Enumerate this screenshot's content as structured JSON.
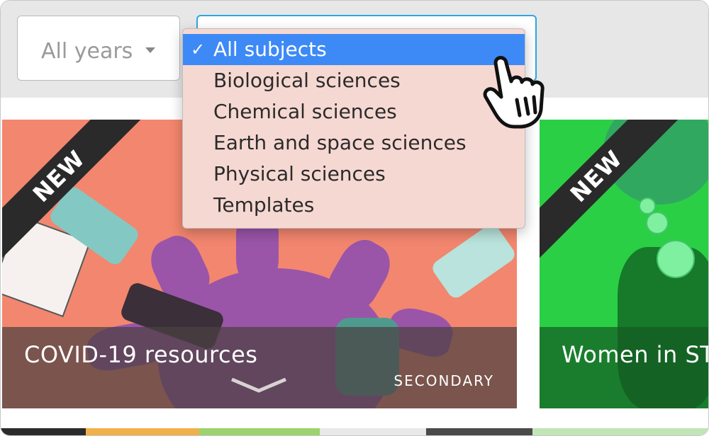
{
  "filters": {
    "year_select": {
      "value": "All years"
    },
    "subject_select": {
      "options": [
        {
          "label": "All subjects",
          "selected": true
        },
        {
          "label": "Biological sciences",
          "selected": false
        },
        {
          "label": "Chemical sciences",
          "selected": false
        },
        {
          "label": "Earth and space sciences",
          "selected": false
        },
        {
          "label": "Physical sciences",
          "selected": false
        },
        {
          "label": "Templates",
          "selected": false
        }
      ],
      "check_mark": "✓"
    }
  },
  "cards": [
    {
      "ribbon": "NEW",
      "title": "COVID-19 resources",
      "level": "SECONDARY",
      "color": "#f3866e"
    },
    {
      "ribbon": "NEW",
      "title": "Women in ST",
      "color": "#2bcf45"
    }
  ],
  "colors": {
    "accent": "#2ea6de",
    "selected_option": "#3d8af6",
    "dropdown_bg": "#f6d8d2"
  },
  "icons": {
    "cursor": "hand-pointer-icon",
    "caret": "caret-down-icon",
    "chevron": "chevron-down-icon"
  }
}
